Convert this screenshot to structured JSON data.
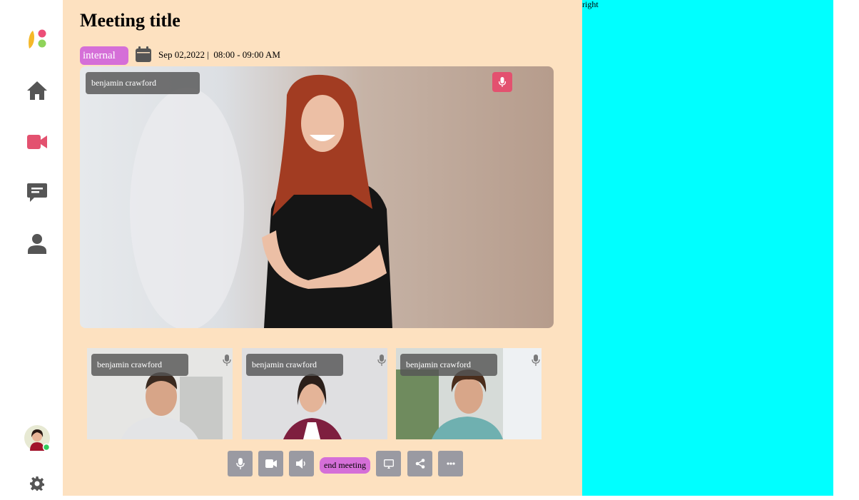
{
  "meeting": {
    "title": "Meeting title",
    "tag": "internal",
    "date": "Sep 02,2022 |",
    "time": "08:00 - 09:00 AM"
  },
  "stage": {
    "participant_name": "benjamin crawford",
    "mic_active": true
  },
  "thumbnails": [
    {
      "name": "benjamin crawford"
    },
    {
      "name": "benjamin crawford"
    },
    {
      "name": "benjamin crawford"
    }
  ],
  "controls": {
    "end_label": "end meeting"
  },
  "sidebar": {
    "items": [
      "home-icon",
      "video-icon",
      "chat-icon",
      "user-icon"
    ],
    "accent": "#e3516f",
    "icon_color": "#555555"
  },
  "right_panel": {
    "label": "right",
    "color": "#00ffff"
  },
  "colors": {
    "main_bg": "#fde1c0",
    "tag_bg": "#d56fd8"
  }
}
